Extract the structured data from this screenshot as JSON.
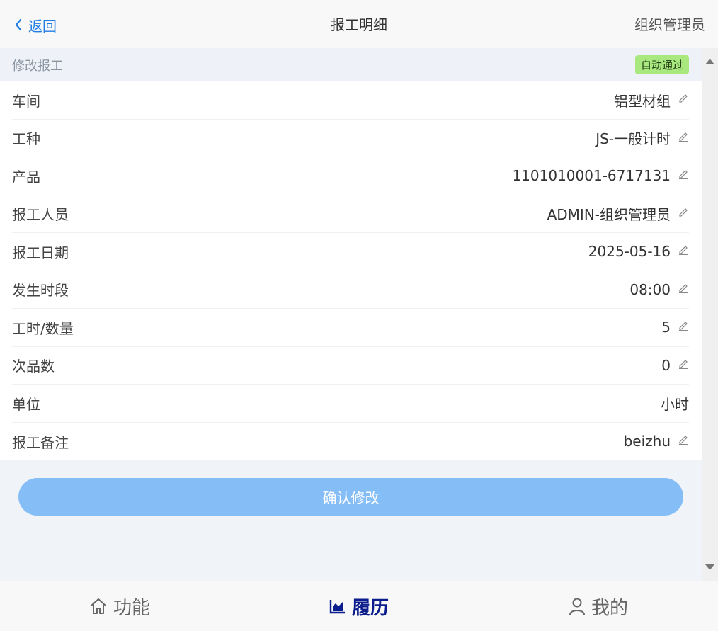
{
  "header": {
    "back_label": "返回",
    "title": "报工明细",
    "user": "组织管理员"
  },
  "section": {
    "title": "修改报工",
    "badge": "自动通过"
  },
  "fields": [
    {
      "label": "车间",
      "value": "铝型材组",
      "editable": true
    },
    {
      "label": "工种",
      "value": "JS-一般计时",
      "editable": true
    },
    {
      "label": "产品",
      "value": "1101010001-6717131",
      "editable": true
    },
    {
      "label": "报工人员",
      "value": "ADMIN-组织管理员",
      "editable": true
    },
    {
      "label": "报工日期",
      "value": "2025-05-16",
      "editable": true
    },
    {
      "label": "发生时段",
      "value": "08:00",
      "editable": true
    },
    {
      "label": "工时/数量",
      "value": "5",
      "editable": true
    },
    {
      "label": "次品数",
      "value": "0",
      "editable": true
    },
    {
      "label": "单位",
      "value": "小时",
      "editable": false
    },
    {
      "label": "报工备注",
      "value": "beizhu",
      "editable": true
    }
  ],
  "confirm_label": "确认修改",
  "tabs": [
    {
      "label": "功能",
      "icon": "home-icon",
      "active": false
    },
    {
      "label": "履历",
      "icon": "chart-icon",
      "active": true
    },
    {
      "label": "我的",
      "icon": "user-icon",
      "active": false
    }
  ],
  "colors": {
    "accent": "#1f7de6",
    "button": "#85bdf7",
    "badge": "#a8e87f",
    "active_tab": "#0b1d8c"
  }
}
